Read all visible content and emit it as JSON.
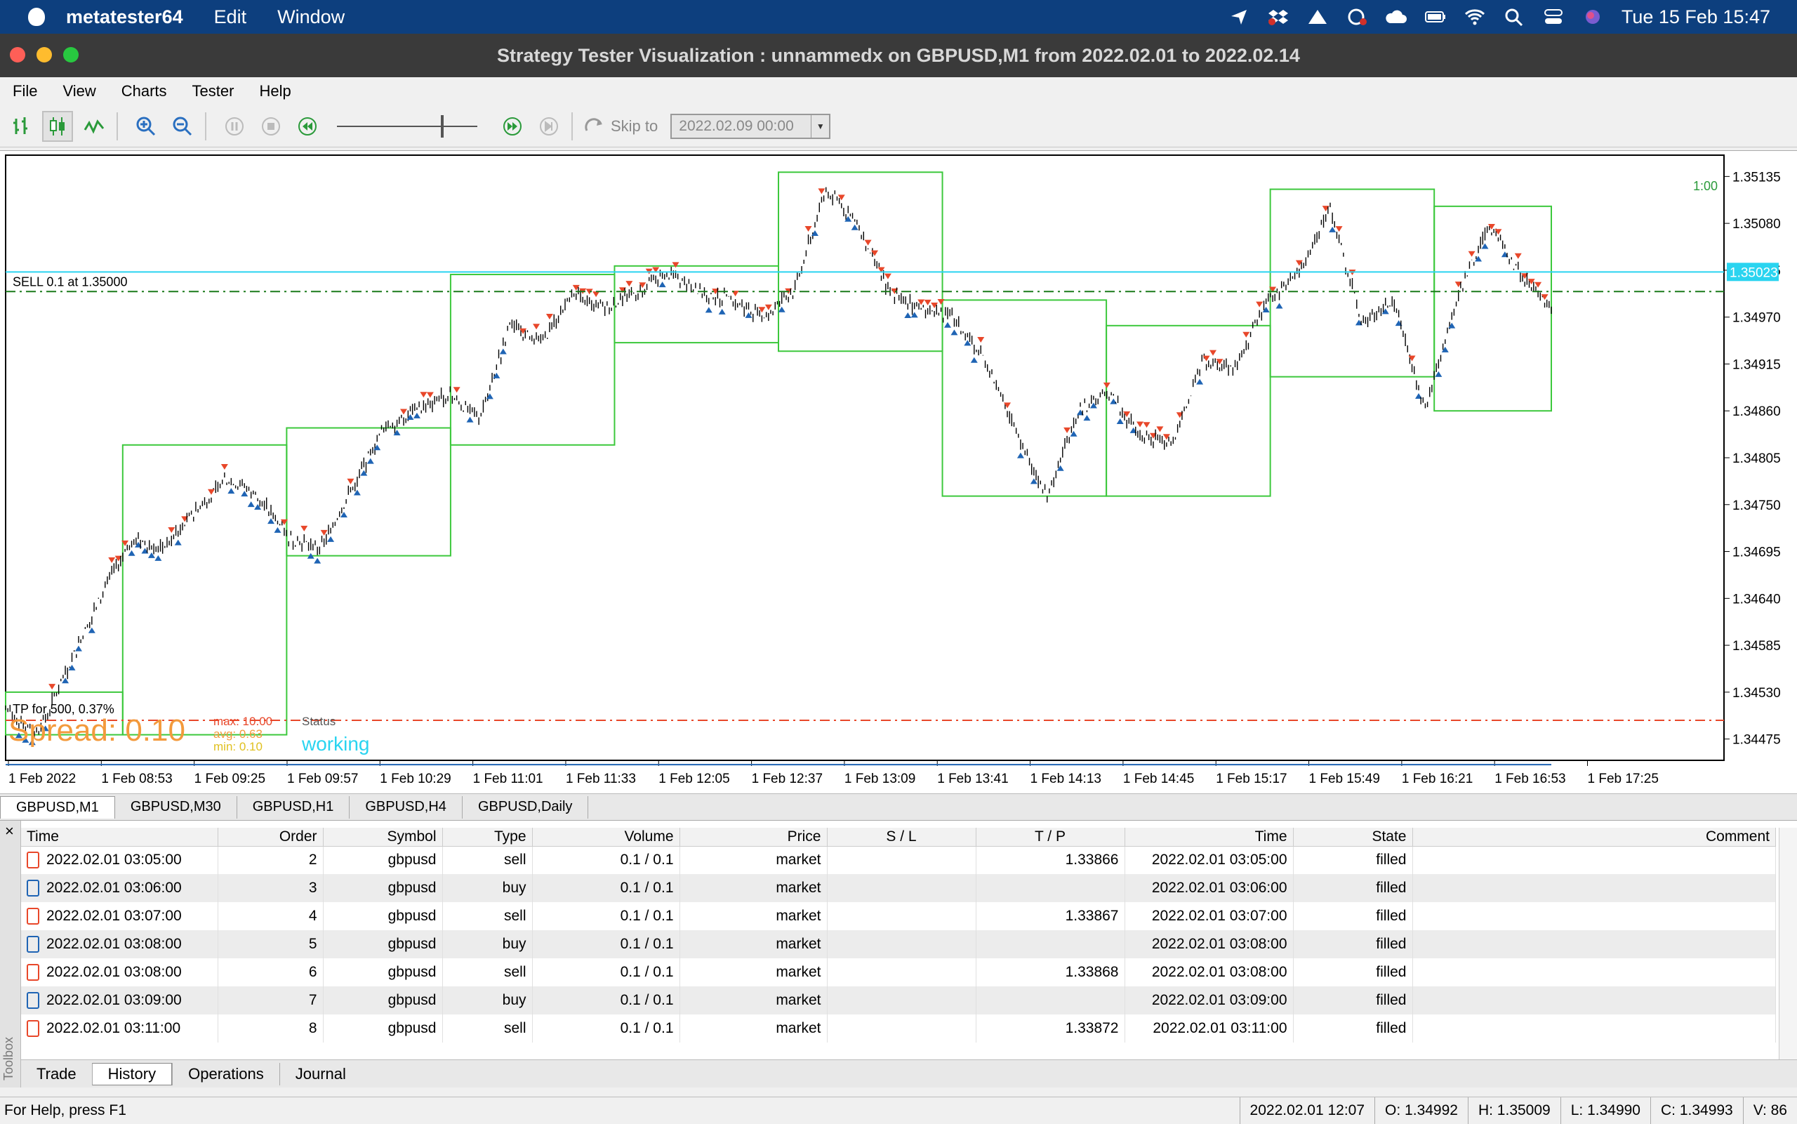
{
  "mac": {
    "app_name": "metatester64",
    "menus": [
      "Edit",
      "Window"
    ],
    "clock": "Tue 15 Feb  15:47"
  },
  "window": {
    "title": "Strategy Tester Visualization : unnammedx on GBPUSD,M1 from 2022.02.01 to 2022.02.14"
  },
  "menubar": [
    "File",
    "View",
    "Charts",
    "Tester",
    "Help"
  ],
  "toolbar": {
    "skip_label": "Skip to",
    "skip_date": "2022.02.09 00:00"
  },
  "chart_data": {
    "type": "candlestick",
    "symbol_timeframe": "GBPUSD,M1",
    "y_ticks": [
      "1.35135",
      "1.35080",
      "1.35025",
      "1.34970",
      "1.34915",
      "1.34860",
      "1.34805",
      "1.34750",
      "1.34695",
      "1.34640",
      "1.34585",
      "1.34530",
      "1.34475"
    ],
    "ylim": [
      1.3445,
      1.3516
    ],
    "x_ticks": [
      "1 Feb 2022",
      "1 Feb 08:53",
      "1 Feb 09:25",
      "1 Feb 09:57",
      "1 Feb 10:29",
      "1 Feb 11:01",
      "1 Feb 11:33",
      "1 Feb 12:05",
      "1 Feb 12:37",
      "1 Feb 13:09",
      "1 Feb 13:41",
      "1 Feb 14:13",
      "1 Feb 14:45",
      "1 Feb 15:17",
      "1 Feb 15:49",
      "1 Feb 16:21",
      "1 Feb 16:53",
      "1 Feb 17:25"
    ],
    "price_path": [
      1.3451,
      1.3448,
      1.3456,
      1.3464,
      1.3471,
      1.347,
      1.3474,
      1.3478,
      1.3476,
      1.3471,
      1.347,
      1.3477,
      1.3484,
      1.3486,
      1.3488,
      1.3485,
      1.3496,
      1.3494,
      1.35,
      1.3498,
      1.35,
      1.3502,
      1.35,
      1.3499,
      1.3497,
      1.35,
      1.3512,
      1.3508,
      1.35,
      1.3498,
      1.3497,
      1.3492,
      1.3484,
      1.3476,
      1.3486,
      1.3488,
      1.3483,
      1.3482,
      1.3492,
      1.3491,
      1.3499,
      1.3502,
      1.351,
      1.3496,
      1.3499,
      1.3486,
      1.3499,
      1.3508,
      1.3502,
      1.3498
    ],
    "current_price_label": "1.35023",
    "current_price": 1.35023,
    "sell_line": {
      "label": "SELL 0.1 at 1.35000",
      "price": 1.35
    },
    "tp_line": {
      "label": "TP for 500, 0.37%",
      "price": 1.34497
    },
    "blue_line_price": 1.34445,
    "boxes": [
      [
        0,
        5,
        1.3448,
        1.3453
      ],
      [
        5,
        12,
        1.3448,
        1.3482
      ],
      [
        12,
        19,
        1.3469,
        1.3484
      ],
      [
        19,
        26,
        1.3482,
        1.3502
      ],
      [
        26,
        33,
        1.3494,
        1.3503
      ],
      [
        33,
        40,
        1.3493,
        1.3514
      ],
      [
        40,
        47,
        1.3476,
        1.3499
      ],
      [
        47,
        54,
        1.3476,
        1.3496
      ],
      [
        54,
        61,
        1.349,
        1.3512
      ],
      [
        61,
        66,
        1.3486,
        1.351
      ]
    ],
    "zoom_label": "1:00",
    "spread_label": "Spread: 0.10",
    "max_label": "max: 10.00",
    "avg_label": "avg: 0.63",
    "min_label": "min: 0.10",
    "status_label": "Status",
    "status_value": "working"
  },
  "chart_tabs": [
    "GBPUSD,M1",
    "GBPUSD,M30",
    "GBPUSD,H1",
    "GBPUSD,H4",
    "GBPUSD,Daily"
  ],
  "orders": {
    "headers": [
      "Time",
      "Order",
      "Symbol",
      "Type",
      "Volume",
      "Price",
      "S / L",
      "T / P",
      "Time",
      "State",
      "Comment"
    ],
    "rows": [
      [
        "2022.02.01 03:05:00",
        "2",
        "gbpusd",
        "sell",
        "0.1 / 0.1",
        "market",
        "",
        "1.33866",
        "2022.02.01 03:05:00",
        "filled",
        ""
      ],
      [
        "2022.02.01 03:06:00",
        "3",
        "gbpusd",
        "buy",
        "0.1 / 0.1",
        "market",
        "",
        "",
        "2022.02.01 03:06:00",
        "filled",
        ""
      ],
      [
        "2022.02.01 03:07:00",
        "4",
        "gbpusd",
        "sell",
        "0.1 / 0.1",
        "market",
        "",
        "1.33867",
        "2022.02.01 03:07:00",
        "filled",
        ""
      ],
      [
        "2022.02.01 03:08:00",
        "5",
        "gbpusd",
        "buy",
        "0.1 / 0.1",
        "market",
        "",
        "",
        "2022.02.01 03:08:00",
        "filled",
        ""
      ],
      [
        "2022.02.01 03:08:00",
        "6",
        "gbpusd",
        "sell",
        "0.1 / 0.1",
        "market",
        "",
        "1.33868",
        "2022.02.01 03:08:00",
        "filled",
        ""
      ],
      [
        "2022.02.01 03:09:00",
        "7",
        "gbpusd",
        "buy",
        "0.1 / 0.1",
        "market",
        "",
        "",
        "2022.02.01 03:09:00",
        "filled",
        ""
      ],
      [
        "2022.02.01 03:11:00",
        "8",
        "gbpusd",
        "sell",
        "0.1 / 0.1",
        "market",
        "",
        "1.33872",
        "2022.02.01 03:11:00",
        "filled",
        ""
      ]
    ]
  },
  "toolbox": {
    "label": "Toolbox",
    "tabs": [
      "Trade",
      "History",
      "Operations",
      "Journal"
    ]
  },
  "status": {
    "help": "For Help, press F1",
    "time": "2022.02.01 12:07",
    "open": "O: 1.34992",
    "high": "H: 1.35009",
    "low": "L: 1.34990",
    "close": "C: 1.34993",
    "volume": "V: 86"
  },
  "colors": {
    "sell": "#e8472a",
    "buy": "#1f64b4",
    "box": "#3cc83c",
    "current": "#2ad4f0"
  }
}
